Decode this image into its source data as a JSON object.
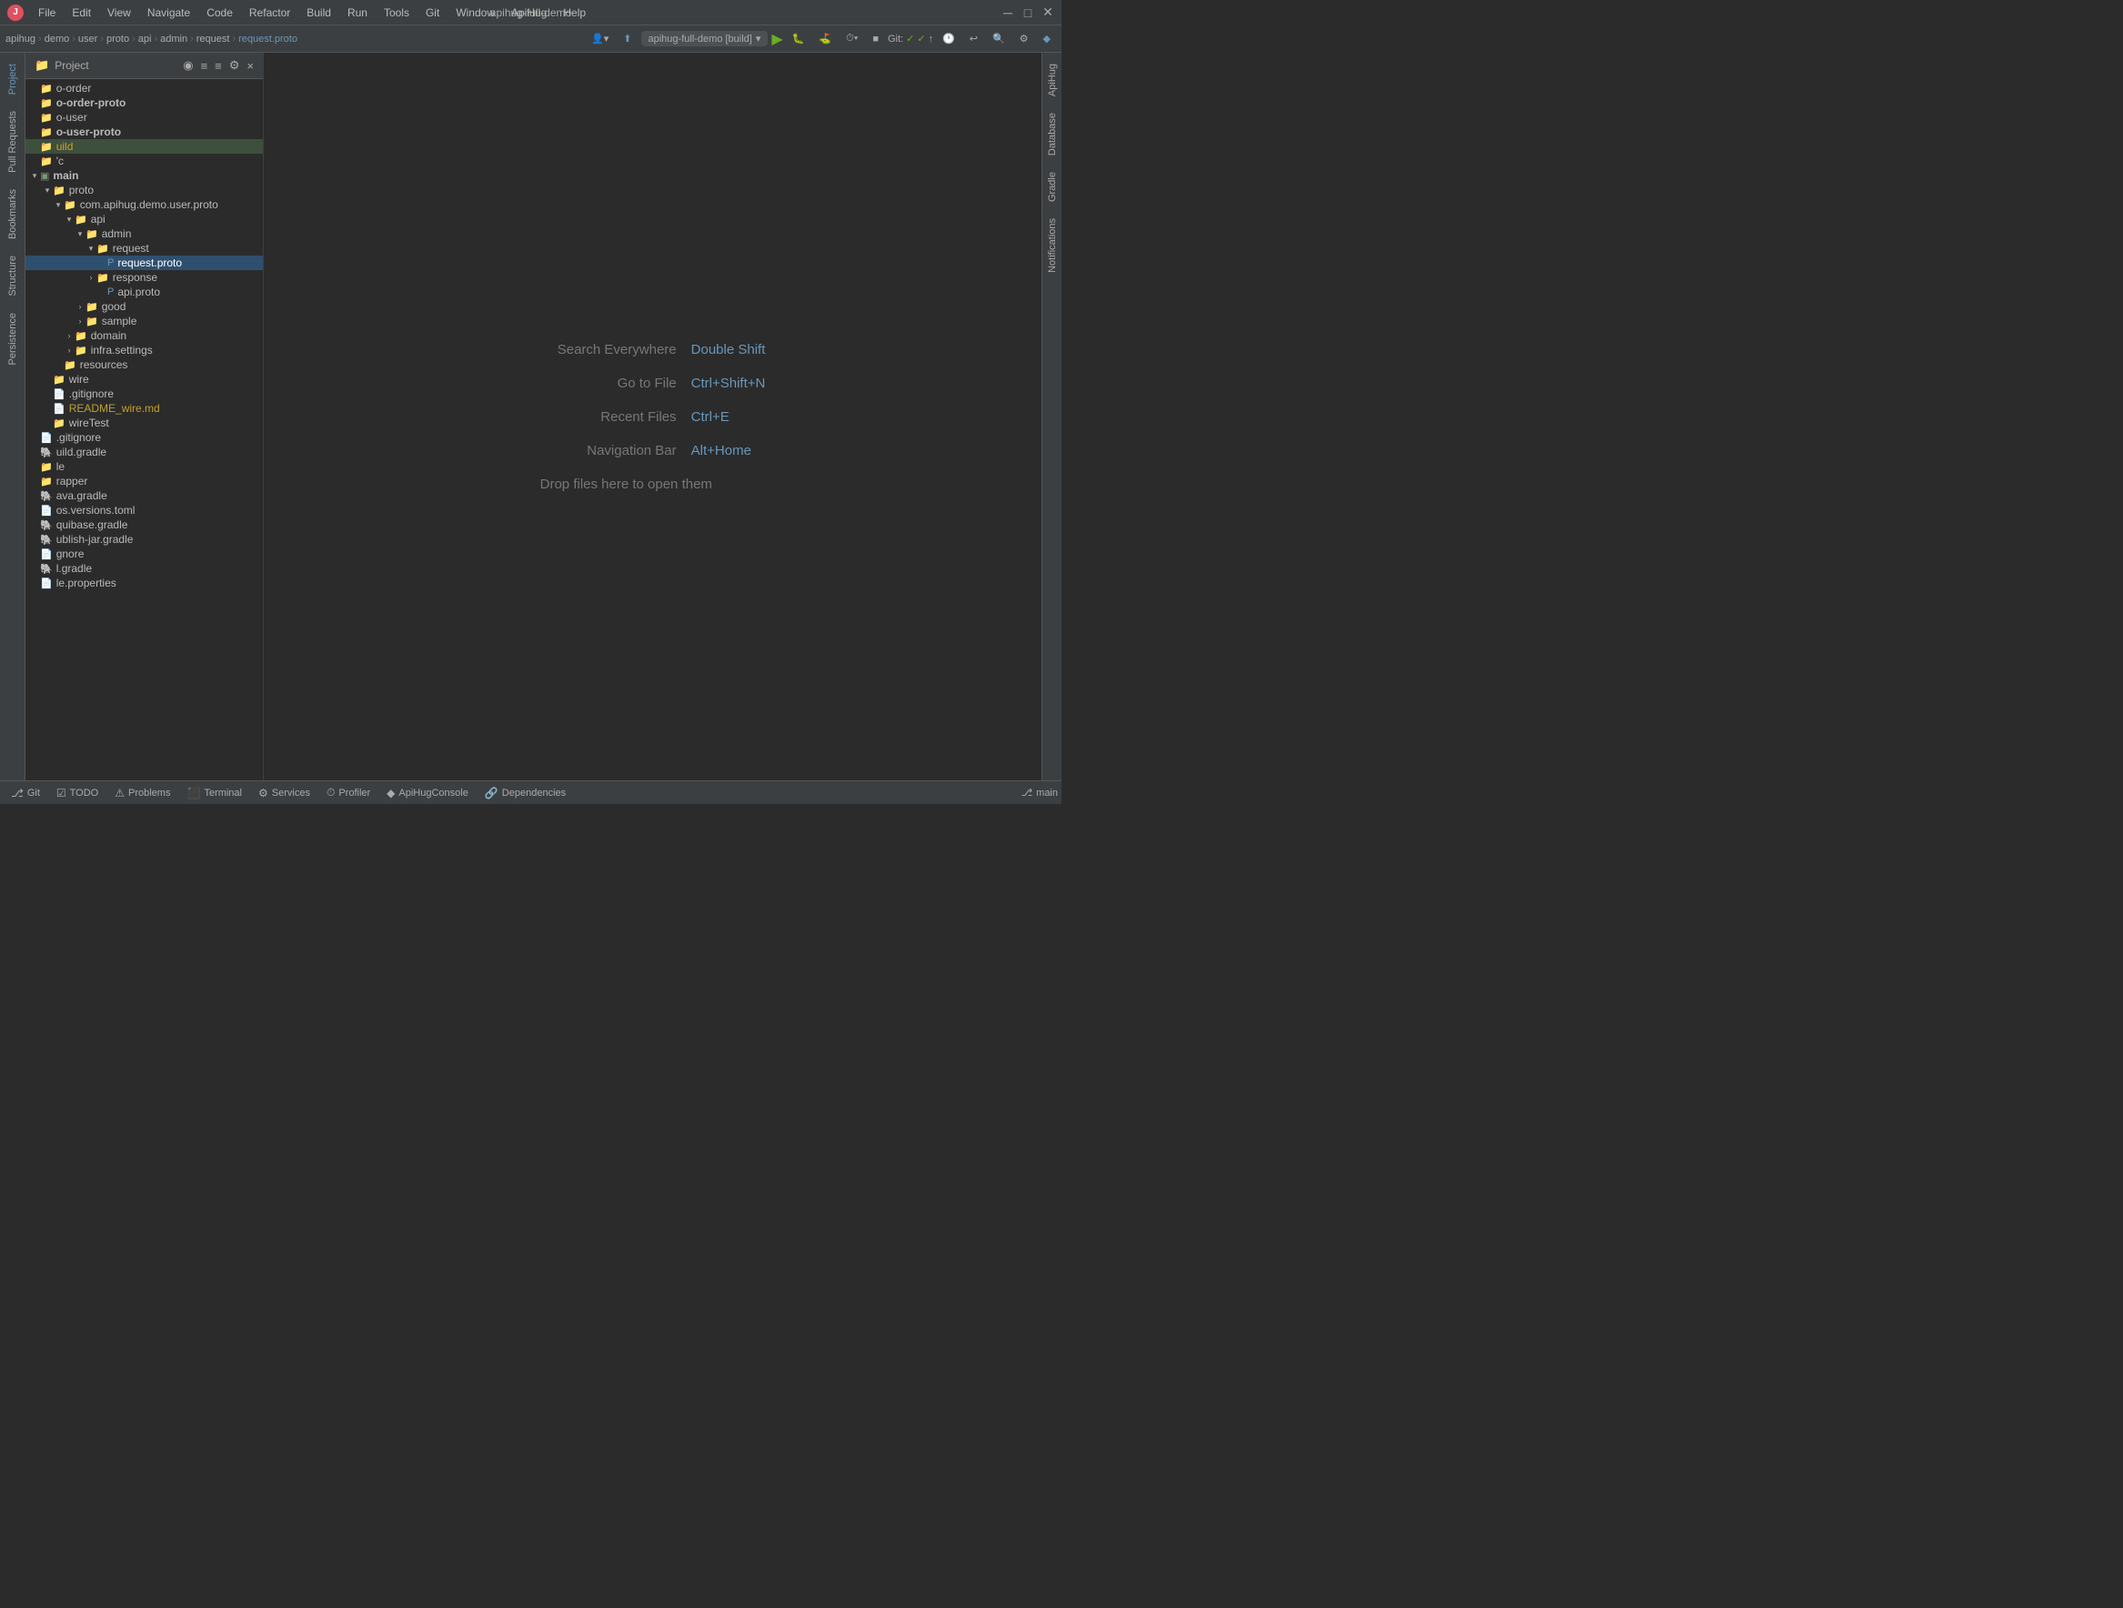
{
  "app": {
    "title": "apihug-full-demo",
    "logo": "J"
  },
  "menu": {
    "items": [
      "File",
      "Edit",
      "View",
      "Navigate",
      "Code",
      "Refactor",
      "Build",
      "Run",
      "Tools",
      "Git",
      "Window",
      "ApiHug",
      "Help"
    ]
  },
  "breadcrumb": {
    "items": [
      "apihug",
      "demo",
      "user",
      "proto",
      "api",
      "admin",
      "request",
      "request.proto"
    ]
  },
  "toolbar": {
    "run_config": "apihug-full-demo [build]",
    "git_label": "Git:",
    "checkmark1": "✓",
    "checkmark2": "✓"
  },
  "project_panel": {
    "title": "Project",
    "tree": [
      {
        "id": 1,
        "indent": 0,
        "arrow": "",
        "icon": "folder",
        "label": "o-order",
        "level": 0
      },
      {
        "id": 2,
        "indent": 0,
        "arrow": "",
        "icon": "folder-bold",
        "label": "o-order-proto",
        "level": 0,
        "bold": true
      },
      {
        "id": 3,
        "indent": 0,
        "arrow": "",
        "icon": "folder",
        "label": "o-user",
        "level": 0
      },
      {
        "id": 4,
        "indent": 0,
        "arrow": "",
        "icon": "folder-bold",
        "label": "o-user-proto",
        "level": 0,
        "bold": true
      },
      {
        "id": 5,
        "indent": 0,
        "arrow": "",
        "icon": "folder-orange",
        "label": "uild",
        "level": 0,
        "color": "orange"
      },
      {
        "id": 6,
        "indent": 0,
        "arrow": "",
        "icon": "folder",
        "label": "c",
        "level": 0
      },
      {
        "id": 7,
        "indent": 0,
        "arrow": "▾",
        "icon": "module",
        "label": "main",
        "level": 0
      },
      {
        "id": 8,
        "indent": 1,
        "arrow": "▾",
        "icon": "folder",
        "label": "proto",
        "level": 1
      },
      {
        "id": 9,
        "indent": 2,
        "arrow": "▾",
        "icon": "folder",
        "label": "com.apihug.demo.user.proto",
        "level": 2
      },
      {
        "id": 10,
        "indent": 3,
        "arrow": "▾",
        "icon": "folder",
        "label": "api",
        "level": 3
      },
      {
        "id": 11,
        "indent": 4,
        "arrow": "▾",
        "icon": "folder",
        "label": "admin",
        "level": 4
      },
      {
        "id": 12,
        "indent": 5,
        "arrow": "▾",
        "icon": "folder",
        "label": "request",
        "level": 5
      },
      {
        "id": 13,
        "indent": 6,
        "arrow": "",
        "icon": "proto",
        "label": "request.proto",
        "level": 6,
        "selected": true
      },
      {
        "id": 14,
        "indent": 5,
        "arrow": "›",
        "icon": "folder",
        "label": "response",
        "level": 5
      },
      {
        "id": 15,
        "indent": 6,
        "arrow": "",
        "icon": "proto",
        "label": "api.proto",
        "level": 6
      },
      {
        "id": 16,
        "indent": 4,
        "arrow": "›",
        "icon": "folder",
        "label": "good",
        "level": 4
      },
      {
        "id": 17,
        "indent": 4,
        "arrow": "›",
        "icon": "folder",
        "label": "sample",
        "level": 4
      },
      {
        "id": 18,
        "indent": 3,
        "arrow": "›",
        "icon": "folder",
        "label": "domain",
        "level": 3
      },
      {
        "id": 19,
        "indent": 3,
        "arrow": "›",
        "icon": "folder",
        "label": "infra.settings",
        "level": 3
      },
      {
        "id": 20,
        "indent": 2,
        "arrow": "",
        "icon": "folder-res",
        "label": "resources",
        "level": 2
      },
      {
        "id": 21,
        "indent": 1,
        "arrow": "",
        "icon": "folder",
        "label": "wire",
        "level": 1
      },
      {
        "id": 22,
        "indent": 1,
        "arrow": "",
        "icon": "gitignore",
        "label": ".gitignore",
        "level": 1
      },
      {
        "id": 23,
        "indent": 1,
        "arrow": "",
        "icon": "readme",
        "label": "README_wire.md",
        "level": 1,
        "color": "readme"
      },
      {
        "id": 24,
        "indent": 1,
        "arrow": "",
        "icon": "folder",
        "label": "wireTest",
        "level": 1
      },
      {
        "id": 25,
        "indent": 0,
        "arrow": "",
        "icon": "gitignore",
        "label": ".gitignore",
        "level": 0
      },
      {
        "id": 26,
        "indent": 0,
        "arrow": "",
        "icon": "gradle",
        "label": "uild.gradle",
        "level": 0
      },
      {
        "id": 27,
        "indent": 0,
        "arrow": "",
        "icon": "folder",
        "label": "le",
        "level": 0
      },
      {
        "id": 28,
        "indent": 0,
        "arrow": "",
        "icon": "folder",
        "label": "rapper",
        "level": 0
      },
      {
        "id": 29,
        "indent": 0,
        "arrow": "",
        "icon": "gradle",
        "label": "ava.gradle",
        "level": 0
      },
      {
        "id": 30,
        "indent": 0,
        "arrow": "",
        "icon": "toml",
        "label": "os.versions.toml",
        "level": 0
      },
      {
        "id": 31,
        "indent": 0,
        "arrow": "",
        "icon": "gradle",
        "label": "quibase.gradle",
        "level": 0
      },
      {
        "id": 32,
        "indent": 0,
        "arrow": "",
        "icon": "gradle",
        "label": "ublish-jar.gradle",
        "level": 0
      },
      {
        "id": 33,
        "indent": 0,
        "arrow": "",
        "icon": "gitignore",
        "label": "gnore",
        "level": 0
      },
      {
        "id": 34,
        "indent": 0,
        "arrow": "",
        "icon": "gradle",
        "label": "l.gradle",
        "level": 0
      },
      {
        "id": 35,
        "indent": 0,
        "arrow": "",
        "icon": "properties",
        "label": "le.properties",
        "level": 0
      }
    ]
  },
  "editor": {
    "hints": [
      {
        "label": "Search Everywhere",
        "shortcut": "Double Shift"
      },
      {
        "label": "Go to File",
        "shortcut": "Ctrl+Shift+N"
      },
      {
        "label": "Recent Files",
        "shortcut": "Ctrl+E"
      },
      {
        "label": "Navigation Bar",
        "shortcut": "Alt+Home"
      },
      {
        "label": "Drop files here to open them",
        "shortcut": ""
      }
    ]
  },
  "right_tabs": [
    "ApiHug",
    "Database",
    "Gradle",
    "Notifications"
  ],
  "left_tabs": [
    "Project",
    "Pull Requests",
    "Bookmarks",
    "Structure",
    "Persistence"
  ],
  "bottom_tabs": [
    {
      "icon": "git",
      "label": "Git"
    },
    {
      "icon": "todo",
      "label": "TODO"
    },
    {
      "icon": "problems",
      "label": "Problems"
    },
    {
      "icon": "terminal",
      "label": "Terminal"
    },
    {
      "icon": "services",
      "label": "Services"
    },
    {
      "icon": "profiler",
      "label": "Profiler"
    },
    {
      "icon": "apihug",
      "label": "ApiHugConsole"
    },
    {
      "icon": "deps",
      "label": "Dependencies"
    }
  ],
  "status_bar": {
    "right_label": "main"
  },
  "colors": {
    "accent_blue": "#6897bb",
    "selected_bg": "#2f4f6f",
    "folder_color": "#7a9c7a",
    "proto_color": "#6897bb",
    "orange": "#d4a020",
    "readme": "#c0a030",
    "run_green": "#6cad22"
  }
}
